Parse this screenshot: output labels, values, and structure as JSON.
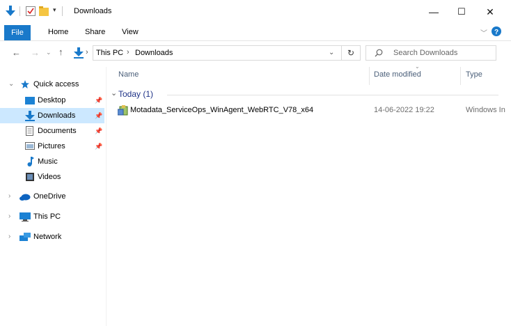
{
  "window": {
    "title": "Downloads"
  },
  "window_controls": {
    "minimize": "—",
    "maximize": "☐",
    "close": "✕"
  },
  "ribbon": {
    "tabs": [
      "File",
      "Home",
      "Share",
      "View"
    ]
  },
  "address": {
    "path": [
      "This PC",
      "Downloads"
    ],
    "search_placeholder": "Search Downloads"
  },
  "nav": {
    "quick_access": "Quick access",
    "items": [
      {
        "label": "Desktop",
        "pinned": true
      },
      {
        "label": "Downloads",
        "pinned": true,
        "selected": true
      },
      {
        "label": "Documents",
        "pinned": true
      },
      {
        "label": "Pictures",
        "pinned": true
      },
      {
        "label": "Music",
        "pinned": false
      },
      {
        "label": "Videos",
        "pinned": false
      }
    ],
    "onedrive": "OneDrive",
    "this_pc": "This PC",
    "network": "Network"
  },
  "list": {
    "columns": {
      "name": "Name",
      "date": "Date modified",
      "type": "Type"
    },
    "group": "Today (1)",
    "rows": [
      {
        "name": "Motadata_ServiceOps_WinAgent_WebRTC_V78_x64",
        "date": "14-06-2022 19:22",
        "type": "Windows In"
      }
    ]
  },
  "colors": {
    "accent": "#1979ca",
    "selection": "#cce8ff",
    "group_text": "#1e3287"
  }
}
